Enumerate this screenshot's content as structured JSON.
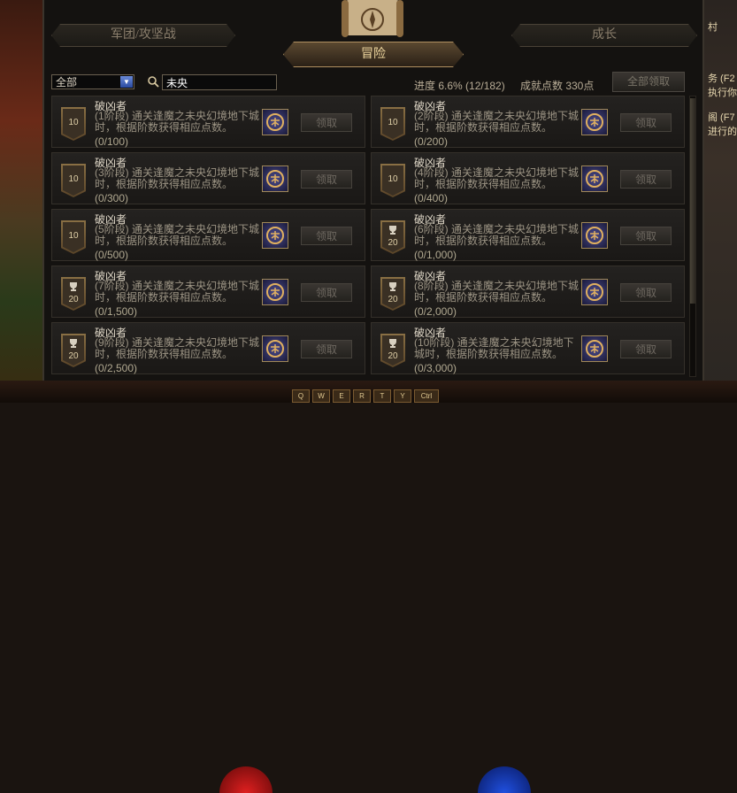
{
  "tabs": {
    "legion": "军团/攻坚战",
    "adventure": "冒险",
    "growth": "成长"
  },
  "filter": {
    "selected": "全部"
  },
  "search": {
    "value": "未央"
  },
  "stats": {
    "progress": "进度  6.6% (12/182)",
    "points": "成就点数 330点"
  },
  "claim_all_label": "全部领取",
  "claim_label": "领取",
  "cards": [
    {
      "name": "破凶者",
      "desc": "(1阶段) 通关逢魔之未央幻境地下城时，根据阶数获得相应点数。",
      "progress": "(0/100)",
      "points": "10",
      "trophy": false
    },
    {
      "name": "破凶者",
      "desc": "(2阶段) 通关逢魔之未央幻境地下城时，根据阶数获得相应点数。",
      "progress": "(0/200)",
      "points": "10",
      "trophy": false
    },
    {
      "name": "破凶者",
      "desc": "(3阶段) 通关逢魔之未央幻境地下城时，根据阶数获得相应点数。",
      "progress": "(0/300)",
      "points": "10",
      "trophy": false
    },
    {
      "name": "破凶者",
      "desc": "(4阶段) 通关逢魔之未央幻境地下城时，根据阶数获得相应点数。",
      "progress": "(0/400)",
      "points": "10",
      "trophy": false
    },
    {
      "name": "破凶者",
      "desc": "(5阶段) 通关逢魔之未央幻境地下城时，根据阶数获得相应点数。",
      "progress": "(0/500)",
      "points": "10",
      "trophy": false
    },
    {
      "name": "破凶者",
      "desc": "(6阶段) 通关逢魔之未央幻境地下城时，根据阶数获得相应点数。",
      "progress": "(0/1,000)",
      "points": "20",
      "trophy": true
    },
    {
      "name": "破凶者",
      "desc": "(7阶段) 通关逢魔之未央幻境地下城时，根据阶数获得相应点数。",
      "progress": "(0/1,500)",
      "points": "20",
      "trophy": true
    },
    {
      "name": "破凶者",
      "desc": "(8阶段) 通关逢魔之未央幻境地下城时，根据阶数获得相应点数。",
      "progress": "(0/2,000)",
      "points": "20",
      "trophy": true
    },
    {
      "name": "破凶者",
      "desc": "(9阶段) 通关逢魔之未央幻境地下城时，根据阶数获得相应点数。",
      "progress": "(0/2,500)",
      "points": "20",
      "trophy": true
    },
    {
      "name": "破凶者",
      "desc": "(10阶段) 通关逢魔之未央幻境地下城时，根据阶数获得相应点数。",
      "progress": "(0/3,000)",
      "points": "20",
      "trophy": true
    }
  ],
  "side_text": [
    "村",
    "务 (F2",
    "执行你",
    "阁 (F7",
    "进行的"
  ],
  "hotkeys": [
    "Q",
    "W",
    "E",
    "R",
    "T",
    "Y",
    "Ctrl"
  ],
  "colors": {
    "accent": "#b09060",
    "panel": "#141210",
    "text": "#e0d8c8"
  }
}
